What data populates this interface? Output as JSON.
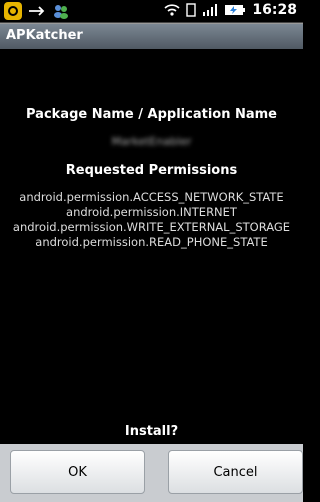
{
  "statusbar": {
    "time": "16:28",
    "icons": [
      "app-notification-icon",
      "usb-icon",
      "messenger-icon",
      "wifi-icon",
      "photo-icon",
      "signal-icon",
      "battery-icon"
    ]
  },
  "titlebar": {
    "title": "APKatcher"
  },
  "dialog": {
    "package_heading": "Package Name / Application Name",
    "package_name": "MarketEnabler",
    "permissions_heading": "Requested Permissions",
    "permissions": [
      "android.permission.ACCESS_NETWORK_STATE",
      "android.permission.INTERNET",
      "android.permission.WRITE_EXTERNAL_STORAGE",
      "android.permission.READ_PHONE_STATE"
    ],
    "prompt": "Install?"
  },
  "buttons": {
    "ok_label": "OK",
    "cancel_label": "Cancel"
  },
  "colors": {
    "titlebar": "#6b7580",
    "background": "#000000",
    "buttonbar": "#c9ccd0"
  }
}
